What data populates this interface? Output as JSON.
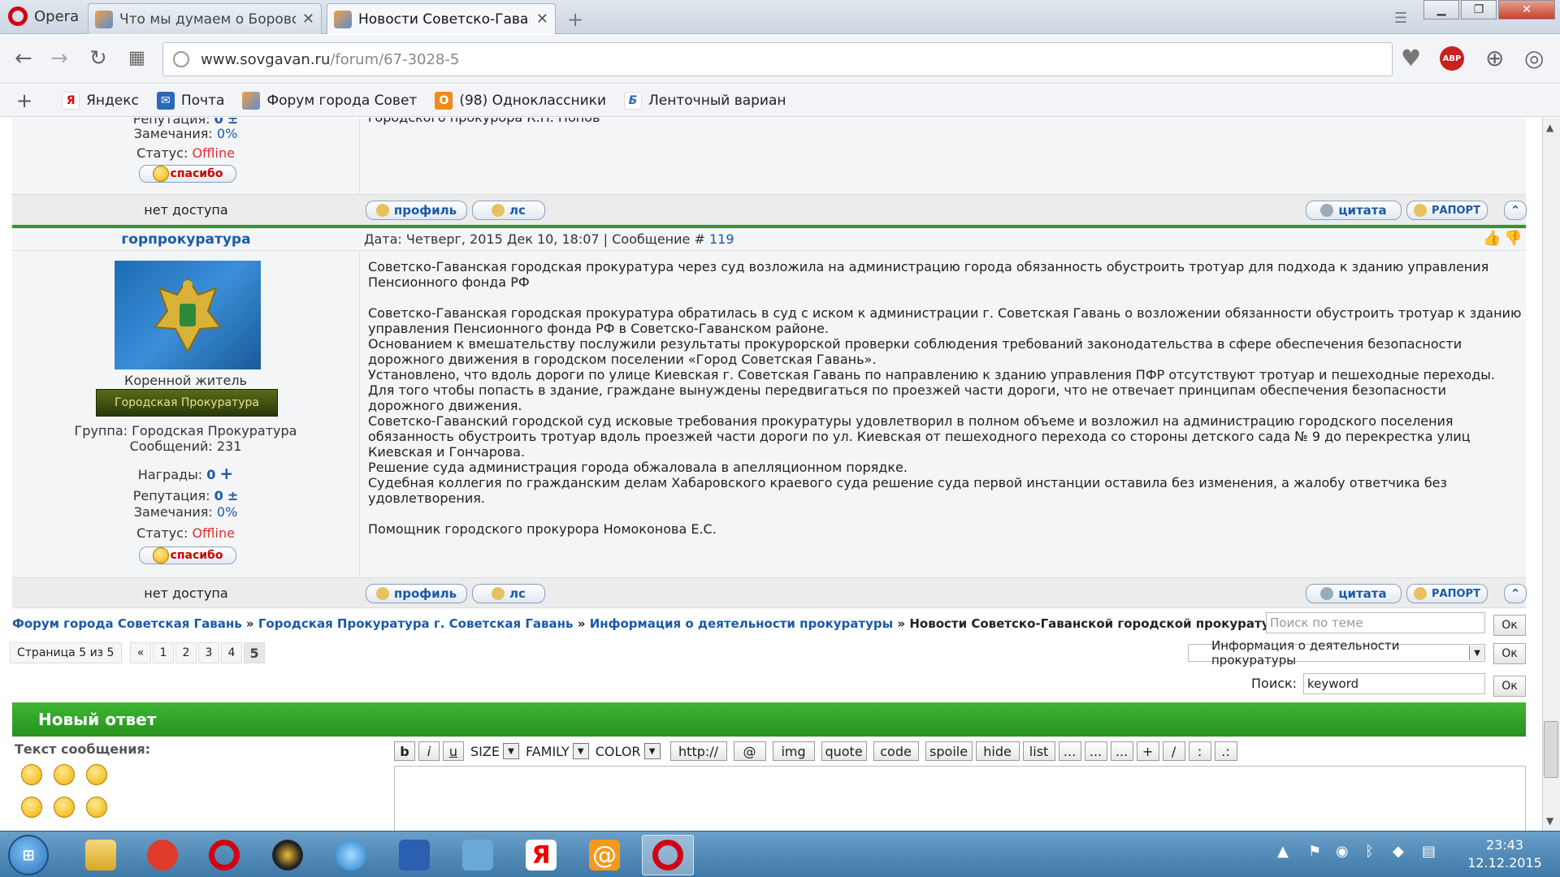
{
  "browser": {
    "app_name": "Opera",
    "tabs": [
      {
        "title": "Что мы думаем о Боровс"
      },
      {
        "title": "Новости Советско-Гаванс"
      }
    ],
    "url_host": "www.sovgavan.ru",
    "url_path": "/forum/67-3028-5",
    "abp_label": "ABP",
    "bookmarks": [
      {
        "label": "Яндекс",
        "icon": "Я"
      },
      {
        "label": "Почта",
        "icon": "✉"
      },
      {
        "label": "Форум города Совет",
        "icon": "◆"
      },
      {
        "label": "(98) Одноклассники",
        "icon": "О"
      },
      {
        "label": "Ленточный вариант",
        "icon": "Б"
      }
    ]
  },
  "post_top": {
    "rep_label": "Репутация:",
    "rep_value": "0",
    "warn_label": "Замечания:",
    "warn_value": "0%",
    "status_label": "Статус:",
    "status_value": "Offline",
    "thanks_label": "спасибо",
    "partial_text": "городского прокурора К.П. Попов",
    "no_access": "нет доступа"
  },
  "post_main": {
    "author": "горпрокуратура",
    "date_label": "Дата: Четверг, 2015 Дек 10, 18:07 | Сообщение #",
    "msg_number": "119",
    "rank": "Коренной житель",
    "rank_banner": "Городская Прокуратура",
    "group": "Группа: Городская Прокуратура",
    "messages": "Сообщений: 231",
    "awards_label": "Награды:",
    "awards_value": "0",
    "rep_label": "Репутация:",
    "rep_value": "0",
    "warn_label": "Замечания:",
    "warn_value": "0%",
    "status_label": "Статус:",
    "status_value": "Offline",
    "thanks_label": "спасибо",
    "no_access": "нет доступа",
    "text": [
      "Советско-Гаванская городская прокуратура через суд возложила на администрацию города обязанность обустроить тротуар для подхода к зданию управления Пенсионного фонда РФ",
      "",
      "Советско-Гаванская городская прокуратура обратилась в суд с иском к администрации г. Советская Гавань о возложении обязанности обустроить тротуар к зданию управления Пенсионного фонда РФ в Советско-Гаванском районе.",
      "Основанием к вмешательству послужили результаты прокурорской проверки соблюдения требований законодательства в сфере обеспечения безопасности дорожного движения в городском поселении «Город Советская Гавань».",
      "Установлено, что вдоль дороги по улице Киевская г. Советская Гавань по направлению к зданию управления ПФР отсутствуют тротуар и пешеходные переходы. Для того чтобы попасть в здание, граждане вынуждены передвигаться по проезжей части дороги, что не отвечает принципам обеспечения безопасности дорожного движения.",
      "Советско-Гаванский городской суд исковые требования прокуратуры удовлетворил в полном объеме и возложил на администрацию городского поселения обязанность обустроить тротуар вдоль проезжей части дороги по ул. Киевская от пешеходного перехода со стороны детского сада № 9 до перекрестка улиц Киевская и Гончарова.",
      "Решение суда администрация города обжаловала в апелляционном порядке.",
      "Судебная коллегия по гражданским делам Хабаровского краевого суда решение суда первой инстанции оставила без изменения, а жалобу ответчика без удовлетворения.",
      "",
      "Помощник городского прокурора Номоконова Е.С."
    ]
  },
  "actions": {
    "profile": "профиль",
    "pm": "лс",
    "quote": "цитата",
    "report": "РАПОРТ"
  },
  "breadcrumbs": {
    "items": [
      "Форум города Советская Гавань",
      "Городская Прокуратура г. Советская Гавань",
      "Информация о деятельности прокуратуры"
    ],
    "sep": "»",
    "current": "Новости Советско-Гаванской городской прокуратуры"
  },
  "search_topic": {
    "placeholder": "Поиск по теме",
    "ok": "Ок"
  },
  "pagination": {
    "label": "Страница 5 из 5",
    "prev": "«",
    "pages": [
      "1",
      "2",
      "3",
      "4"
    ],
    "current": "5"
  },
  "forum_jump": {
    "selected": "Информация о деятельности прокуратуры",
    "ok": "Ок"
  },
  "search": {
    "label": "Поиск:",
    "value": "keyword",
    "ok": "Ок"
  },
  "reply": {
    "title": "Новый ответ",
    "text_label": "Текст сообщения:",
    "toolbar": {
      "b": "b",
      "i": "i",
      "u": "u",
      "size": "SIZE",
      "family": "FAMILY",
      "color": "COLOR",
      "http": "http://",
      "at": "@",
      "img": "img",
      "quote": "quote",
      "code": "code",
      "spoiler": "spoile",
      "hide": "hide",
      "list": "list",
      "dots1": "...",
      "dots2": "...",
      "dots3": "...",
      "plus": "+",
      "slash": "/",
      "colon1": ":",
      "colon2": ".:"
    }
  },
  "taskbar": {
    "time": "23:43",
    "date": "12.12.2015"
  }
}
